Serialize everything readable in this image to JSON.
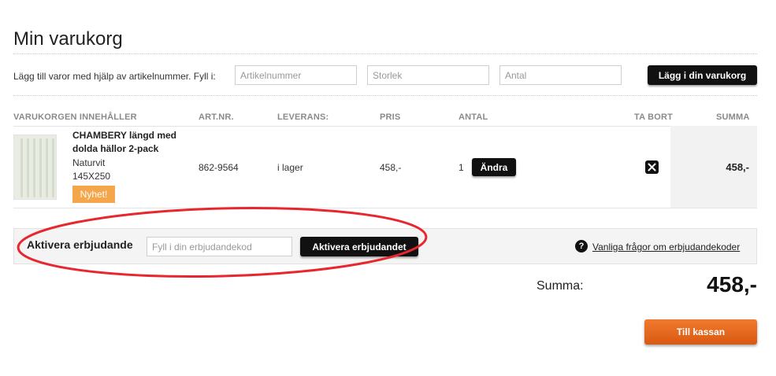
{
  "page": {
    "title": "Min varukorg"
  },
  "add_items": {
    "label": "Lägg till varor med hjälp av artikelnummer. Fyll i:",
    "article_placeholder": "Artikelnummer",
    "size_placeholder": "Storlek",
    "quantity_placeholder": "Antal",
    "add_button": "Lägg i din varukorg"
  },
  "cart_table": {
    "headers": {
      "contents": "VARUKORGEN INNEHÅLLER",
      "art_nr": "ART.NR.",
      "delivery": "LEVERANS:",
      "price": "PRIS",
      "quantity": "ANTAL",
      "remove": "TA BORT",
      "sum": "SUMMA"
    },
    "items": [
      {
        "name": "CHAMBERY längd med dolda hällor 2-pack",
        "color": "Naturvit",
        "size": "145X250",
        "badge": "Nyhet!",
        "art_nr": "862-9564",
        "delivery": "i lager",
        "price": "458,-",
        "quantity": "1",
        "change_button": "Ändra",
        "remove_icon": "close-icon",
        "sum": "458,-"
      }
    ]
  },
  "offer": {
    "label": "Aktivera erbjudande",
    "code_placeholder": "Fyll i din erbjudandekod",
    "activate_button": "Aktivera erbjudandet",
    "help_icon": "question-icon",
    "help_link": "Vanliga frågor om erbjudandekoder"
  },
  "totals": {
    "label": "Summa:",
    "value": "458,-"
  },
  "checkout": {
    "button": "Till kassan"
  },
  "colors": {
    "accent_orange": "#e2691d",
    "badge_orange": "#f5a54a",
    "button_black": "#111111",
    "annotation_red": "#e8262d"
  }
}
